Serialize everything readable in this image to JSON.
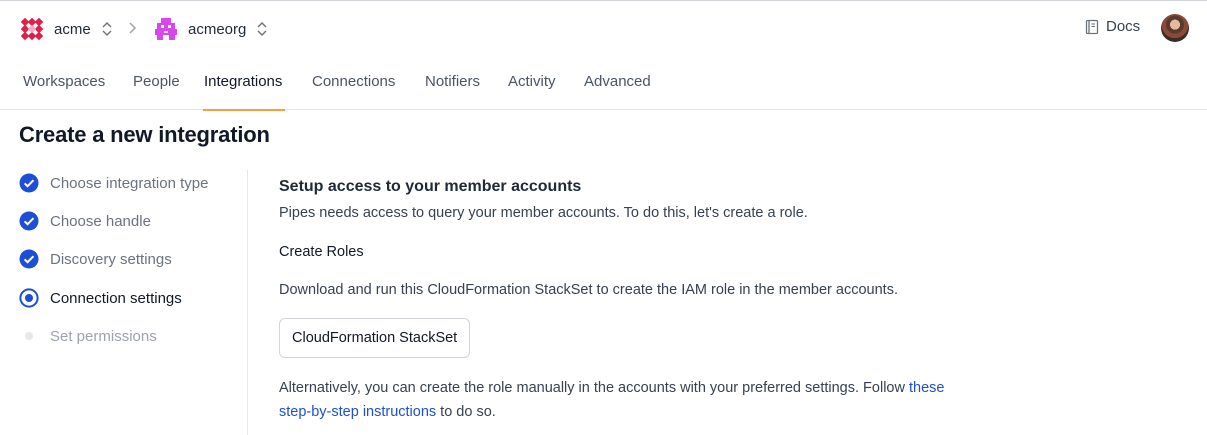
{
  "header": {
    "org": {
      "name": "acme"
    },
    "workspace": {
      "name": "acmeorg"
    },
    "docs_label": "Docs"
  },
  "tabs": [
    {
      "label": "Workspaces",
      "active": false
    },
    {
      "label": "People",
      "active": false
    },
    {
      "label": "Integrations",
      "active": true
    },
    {
      "label": "Connections",
      "active": false
    },
    {
      "label": "Notifiers",
      "active": false
    },
    {
      "label": "Activity",
      "active": false
    },
    {
      "label": "Advanced",
      "active": false
    }
  ],
  "page": {
    "title": "Create a new integration"
  },
  "steps": [
    {
      "label": "Choose integration type",
      "status": "complete"
    },
    {
      "label": "Choose handle",
      "status": "complete"
    },
    {
      "label": "Discovery settings",
      "status": "complete"
    },
    {
      "label": "Connection settings",
      "status": "current"
    },
    {
      "label": "Set permissions",
      "status": "pending"
    }
  ],
  "content": {
    "heading": "Setup access to your member accounts",
    "intro": "Pipes needs access to query your member accounts. To do this, let's create a role.",
    "subheading": "Create Roles",
    "download_text": "Download and run this CloudFormation StackSet to create the IAM role in the member accounts.",
    "stackset_button": "CloudFormation StackSet",
    "alt_text_1": "Alternatively, you can create the role manually in the accounts with your preferred settings. Follow ",
    "alt_link_1": "these",
    "alt_link_2": "step-by-step instructions",
    "alt_text_2": " to do so."
  },
  "colors": {
    "accent_tab": "#f59e42",
    "step_blue": "#1d4ed8",
    "link": "#1d4ed8",
    "org_logo": "#e11d48",
    "workspace_logo": "#d946ef"
  }
}
